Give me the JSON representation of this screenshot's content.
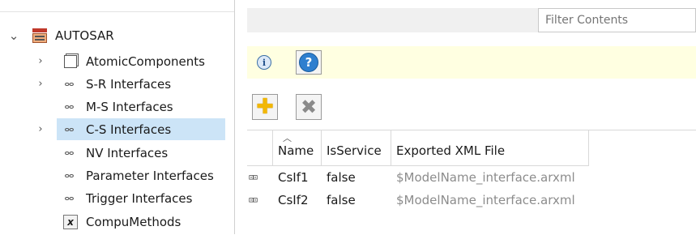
{
  "tree": {
    "root_label": "AUTOSAR",
    "items": [
      {
        "label": "AtomicComponents",
        "icon": "component-box-icon",
        "expandable": true
      },
      {
        "label": "S-R Interfaces",
        "icon": "interface-icon",
        "expandable": true
      },
      {
        "label": "M-S Interfaces",
        "icon": "interface-icon",
        "expandable": false
      },
      {
        "label": "C-S Interfaces",
        "icon": "interface-icon",
        "expandable": true,
        "selected": true
      },
      {
        "label": "NV Interfaces",
        "icon": "interface-icon",
        "expandable": false
      },
      {
        "label": "Parameter Interfaces",
        "icon": "interface-icon",
        "expandable": false
      },
      {
        "label": "Trigger Interfaces",
        "icon": "interface-icon",
        "expandable": false
      },
      {
        "label": "CompuMethods",
        "icon": "compu-method-icon",
        "expandable": false
      }
    ]
  },
  "filter": {
    "placeholder": "Filter Contents"
  },
  "toolbar": {
    "info_icon": "info-icon",
    "help_icon": "help-icon",
    "add_icon": "add-icon",
    "delete_icon": "delete-icon"
  },
  "table": {
    "columns": [
      "Name",
      "IsService",
      "Exported XML File"
    ],
    "rows": [
      {
        "name": "CsIf1",
        "is_service": "false",
        "xml_file": "$ModelName_interface.arxml"
      },
      {
        "name": "CsIf2",
        "is_service": "false",
        "xml_file": "$ModelName_interface.arxml"
      }
    ]
  },
  "colors": {
    "selection": "#cce4f7",
    "info_bar": "#ffffe1",
    "muted_text": "#8c8c8c"
  }
}
